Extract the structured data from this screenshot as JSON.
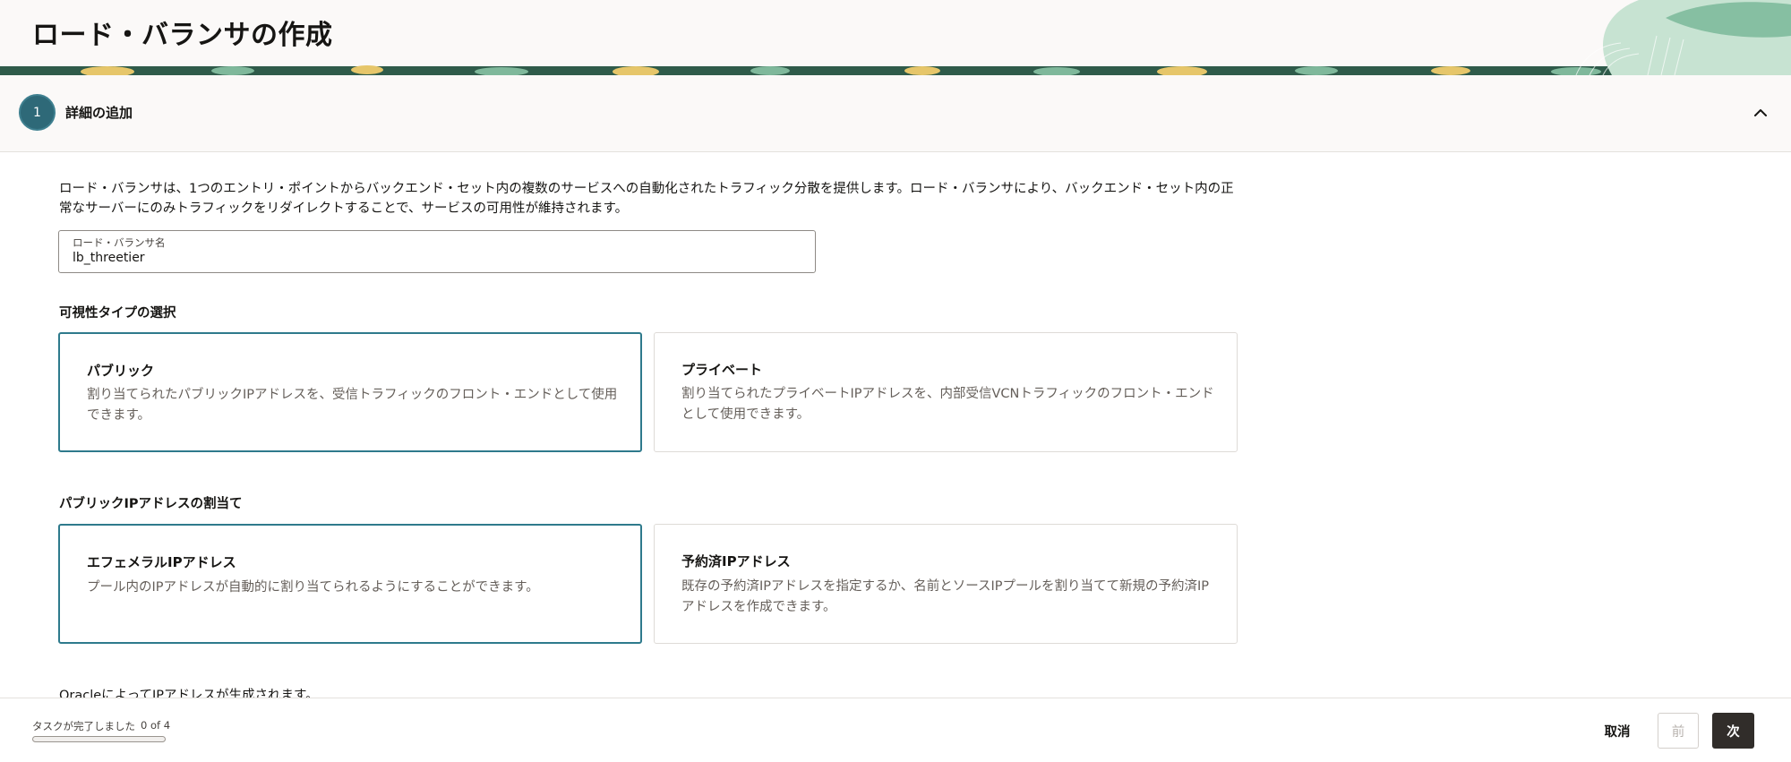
{
  "page": {
    "title": "ロード・バランサの作成"
  },
  "step": {
    "number": "1",
    "label": "詳細の追加"
  },
  "details": {
    "description": "ロード・バランサは、1つのエントリ・ポイントからバックエンド・セット内の複数のサービスへの自動化されたトラフィック分散を提供します。ロード・バランサにより、バックエンド・セット内の正常なサーバーにのみトラフィックをリダイレクトすることで、サービスの可用性が維持されます。",
    "name_field": {
      "label": "ロード・バランサ名",
      "value": "lb_threetier"
    }
  },
  "visibility": {
    "title": "可視性タイプの選択",
    "options": [
      {
        "title": "パブリック",
        "description": "割り当てられたパブリックIPアドレスを、受信トラフィックのフロント・エンドとして使用できます。",
        "selected": true
      },
      {
        "title": "プライベート",
        "description": "割り当てられたプライベートIPアドレスを、内部受信VCNトラフィックのフロント・エンドとして使用できます。",
        "selected": false
      }
    ]
  },
  "ip_assignment": {
    "title": "パブリックIPアドレスの割当て",
    "options": [
      {
        "title": "エフェメラルIPアドレス",
        "description": "プール内のIPアドレスが自動的に割り当てられるようにすることができます。",
        "selected": true
      },
      {
        "title": "予約済IPアドレス",
        "description": "既存の予約済IPアドレスを指定するか、名前とソースIPプールを割り当てて新規の予約済IPアドレスを作成できます。",
        "selected": false
      }
    ],
    "note": "OracleによってIPアドレスが生成されます。"
  },
  "footer": {
    "task_label": "タスクが完了しました",
    "task_count": "0 of 4",
    "progress_fraction": 0,
    "cancel_label": "取消",
    "prev_label": "前",
    "next_label": "次"
  },
  "colors": {
    "accent": "#2e6978",
    "selected_border": "#2e7a8c",
    "primary_button": "#312d2a",
    "header_bg": "#fbf9f8",
    "pattern_dark": "#2f5b4a",
    "pattern_yellow": "#e6c66a",
    "pattern_light": "#b7dcc5"
  },
  "icons": {
    "collapse": "chevron-up-icon"
  }
}
